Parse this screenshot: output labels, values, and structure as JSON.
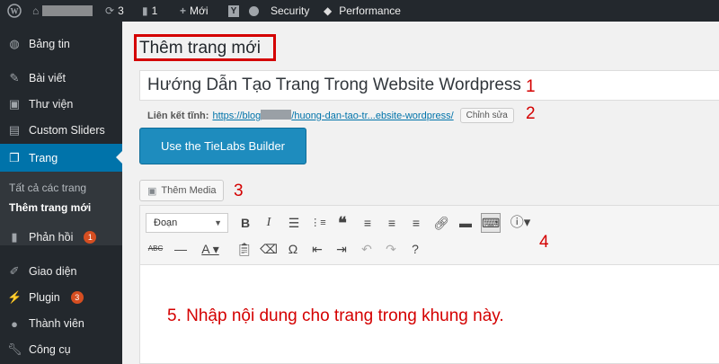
{
  "adminbar": {
    "updates_count": "3",
    "comments_count": "1",
    "new_label": "Mới",
    "security_label": "Security",
    "performance_label": "Performance"
  },
  "sidebar": {
    "items": [
      {
        "label": "Bảng tin",
        "icon": "dashboard-icon"
      },
      {
        "label": "Bài viết",
        "icon": "pin-icon"
      },
      {
        "label": "Thư viện",
        "icon": "media-icon"
      },
      {
        "label": "Custom Sliders",
        "icon": "slides-icon"
      },
      {
        "label": "Trang",
        "icon": "page-icon"
      },
      {
        "label": "Phản hồi",
        "icon": "comment-icon",
        "badge": "1"
      },
      {
        "label": "Giao diện",
        "icon": "brush-icon"
      },
      {
        "label": "Plugin",
        "icon": "plugin-icon",
        "badge": "3"
      },
      {
        "label": "Thành viên",
        "icon": "user-icon"
      },
      {
        "label": "Công cụ",
        "icon": "wrench-icon"
      }
    ],
    "submenu": [
      "Tất cả các trang",
      "Thêm trang mới"
    ]
  },
  "main": {
    "page_title": "Thêm trang mới",
    "title_value": "Hướng Dẫn Tạo Trang Trong Website Wordpress",
    "permalink_label": "Liên kết tĩnh:",
    "permalink_start": "https://blog",
    "permalink_end": "/huong-dan-tao-tr...ebsite-wordpress/",
    "edit_label": "Chỉnh sửa",
    "builder_label": "Use the TieLabs Builder",
    "add_media_label": "Thêm Media",
    "format_value": "Đoạn",
    "editor_text": "5. Nhập nội dung cho trang trong khung này."
  },
  "annotations": {
    "n1": "1",
    "n2": "2",
    "n3": "3",
    "n4": "4"
  },
  "colors": {
    "accent": "#0073aa",
    "annotation": "#d40000",
    "adminbar": "#23282d"
  }
}
